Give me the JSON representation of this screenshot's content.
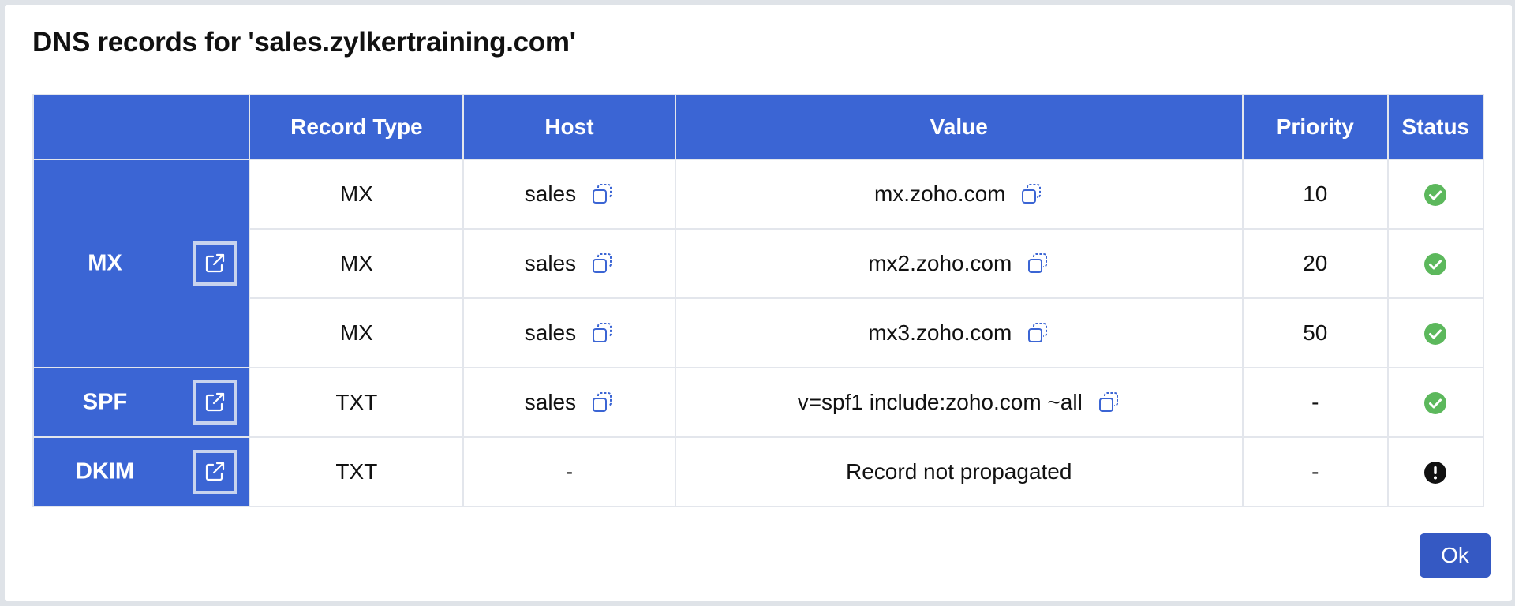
{
  "dialog": {
    "title": "DNS records for 'sales.zylkertraining.com'",
    "ok_label": "Ok"
  },
  "columns": {
    "group": "",
    "record_type": "Record Type",
    "host": "Host",
    "value": "Value",
    "priority": "Priority",
    "status": "Status"
  },
  "groups": {
    "mx": "MX",
    "spf": "SPF",
    "dkim": "DKIM"
  },
  "rows": [
    {
      "type": "MX",
      "host": "sales",
      "value": "mx.zoho.com",
      "priority": "10",
      "status": "verified"
    },
    {
      "type": "MX",
      "host": "sales",
      "value": "mx2.zoho.com",
      "priority": "20",
      "status": "verified"
    },
    {
      "type": "MX",
      "host": "sales",
      "value": "mx3.zoho.com",
      "priority": "50",
      "status": "verified"
    },
    {
      "type": "TXT",
      "host": "sales",
      "value": "v=spf1 include:zoho.com ~all",
      "priority": "-",
      "status": "verified"
    },
    {
      "type": "TXT",
      "host": "-",
      "value": "Record not propagated",
      "priority": "-",
      "status": "error"
    }
  ],
  "colors": {
    "header_bg": "#3b65d4",
    "ok_button": "#3559c3",
    "verified": "#5cb85c",
    "error": "#111111"
  },
  "icons": {
    "copy": "copy-icon",
    "external_link": "external-link-icon",
    "verified": "check-circle-icon",
    "error": "exclamation-circle-icon"
  }
}
